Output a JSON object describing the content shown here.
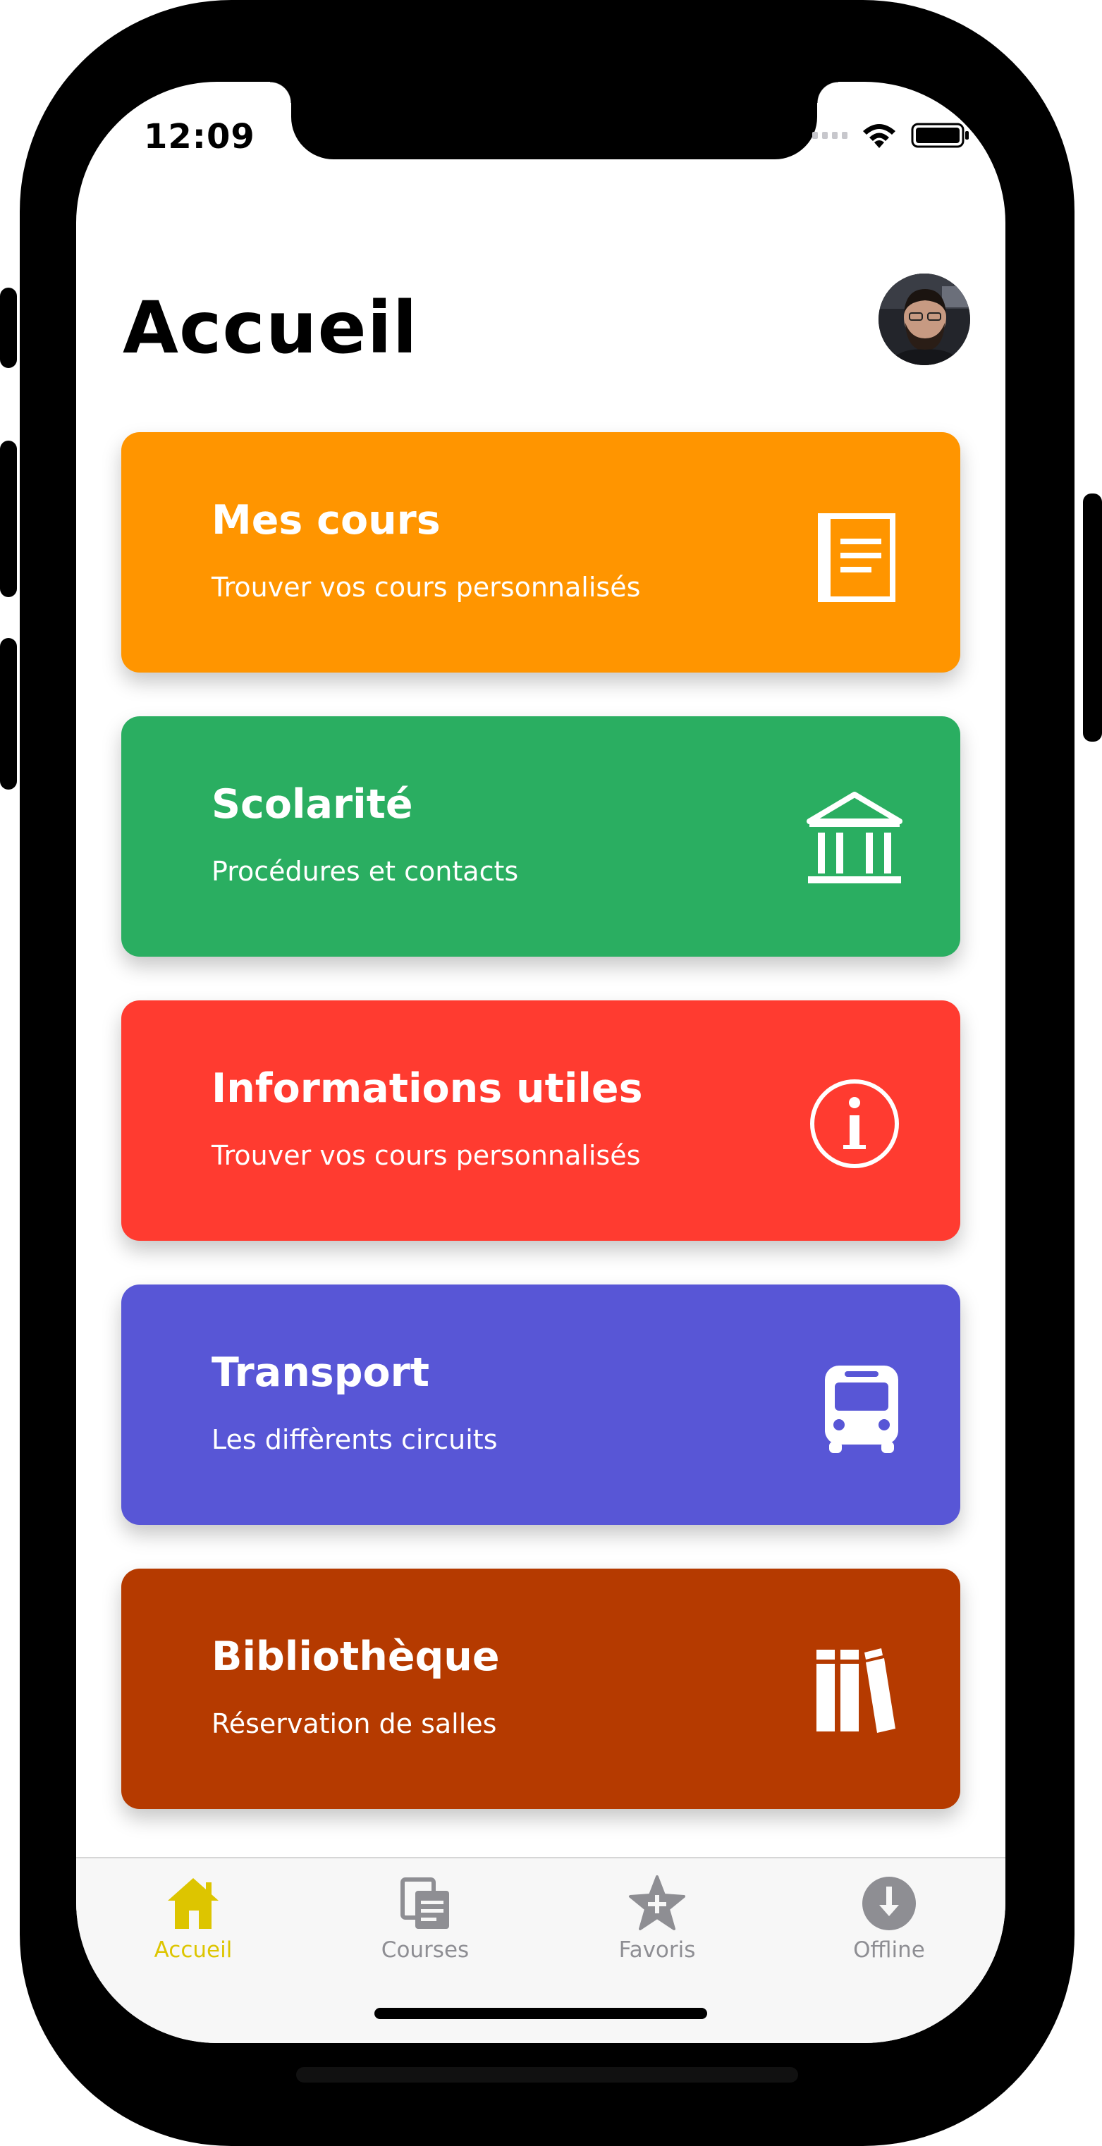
{
  "status": {
    "time": "12:09"
  },
  "header": {
    "title": "Accueil"
  },
  "cards": [
    {
      "title": "Mes cours",
      "subtitle": "Trouver vos cours personnalisés",
      "icon": "book-icon",
      "color": "#FF9500"
    },
    {
      "title": "Scolarité",
      "subtitle": "Procédures et contacts",
      "icon": "building-icon",
      "color": "#2AAE61"
    },
    {
      "title": "Informations utiles",
      "subtitle": "Trouver vos cours personnalisés",
      "icon": "info-icon",
      "color": "#FF3B30"
    },
    {
      "title": "Transport",
      "subtitle": "Les diffèrents circuits",
      "icon": "bus-icon",
      "color": "#5856D6"
    },
    {
      "title": "Bibliothèque",
      "subtitle": "Réservation de salles",
      "icon": "library-icon",
      "color": "#B53A00"
    }
  ],
  "tabbar": {
    "active_color": "#DDC500",
    "inactive_color": "#8E8E93",
    "tabs": [
      {
        "label": "Accueil",
        "icon": "home-icon",
        "active": true
      },
      {
        "label": "Courses",
        "icon": "courses-icon",
        "active": false
      },
      {
        "label": "Favoris",
        "icon": "favorite-star-icon",
        "active": false
      },
      {
        "label": "Offline",
        "icon": "download-icon",
        "active": false
      }
    ]
  }
}
